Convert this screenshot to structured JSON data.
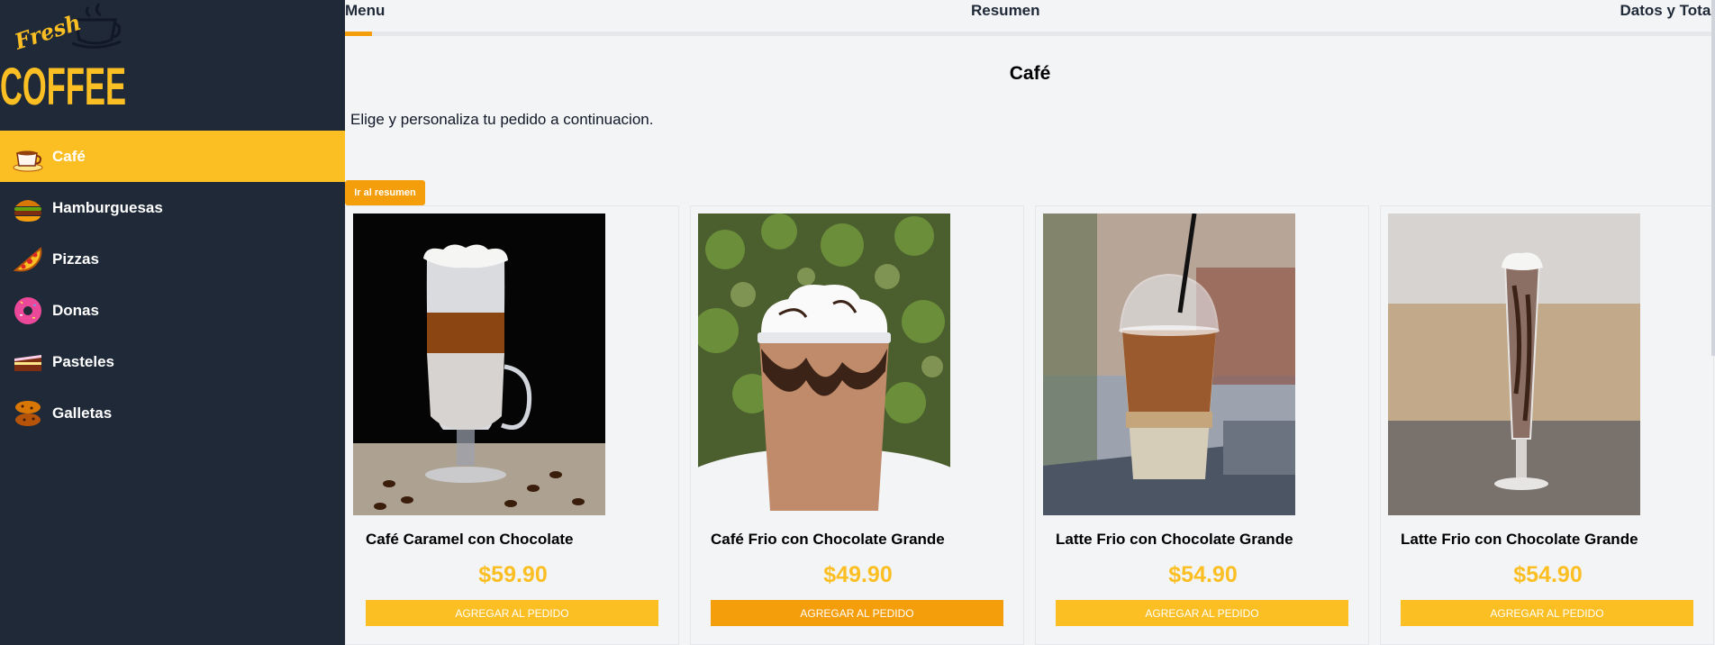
{
  "brand": {
    "logo_top": "Fresh",
    "logo_main": "COFFEE"
  },
  "sidebar": {
    "items": [
      {
        "label": "Café",
        "icon": "coffee-cup-icon",
        "active": true
      },
      {
        "label": "Hamburguesas",
        "icon": "burger-icon",
        "active": false
      },
      {
        "label": "Pizzas",
        "icon": "pizza-icon",
        "active": false
      },
      {
        "label": "Donas",
        "icon": "donut-icon",
        "active": false
      },
      {
        "label": "Pasteles",
        "icon": "cake-icon",
        "active": false
      },
      {
        "label": "Galletas",
        "icon": "cookies-icon",
        "active": false
      }
    ]
  },
  "steps": {
    "menu": "Menu",
    "resumen": "Resumen",
    "datos": "Datos y Total",
    "progress_percent": 2
  },
  "main": {
    "category_title": "Café",
    "subtitle": "Elige y personaliza tu pedido a continuacion.",
    "resumen_button": "Ir al resumen"
  },
  "products": [
    {
      "name": "Café Caramel con Chocolate",
      "price": "$59.90",
      "button": "AGREGAR AL PEDIDO"
    },
    {
      "name": "Café Frio con Chocolate Grande",
      "price": "$49.90",
      "button": "AGREGAR AL PEDIDO"
    },
    {
      "name": "Latte Frio con Chocolate Grande",
      "price": "$54.90",
      "button": "AGREGAR AL PEDIDO"
    },
    {
      "name": "Latte Frio con Chocolate Grande",
      "price": "$54.90",
      "button": "AGREGAR AL PEDIDO"
    }
  ],
  "colors": {
    "sidebar_bg": "#1f2937",
    "accent": "#fbbf24",
    "accent_dark": "#f59e0b",
    "page_bg": "#f3f4f6"
  }
}
